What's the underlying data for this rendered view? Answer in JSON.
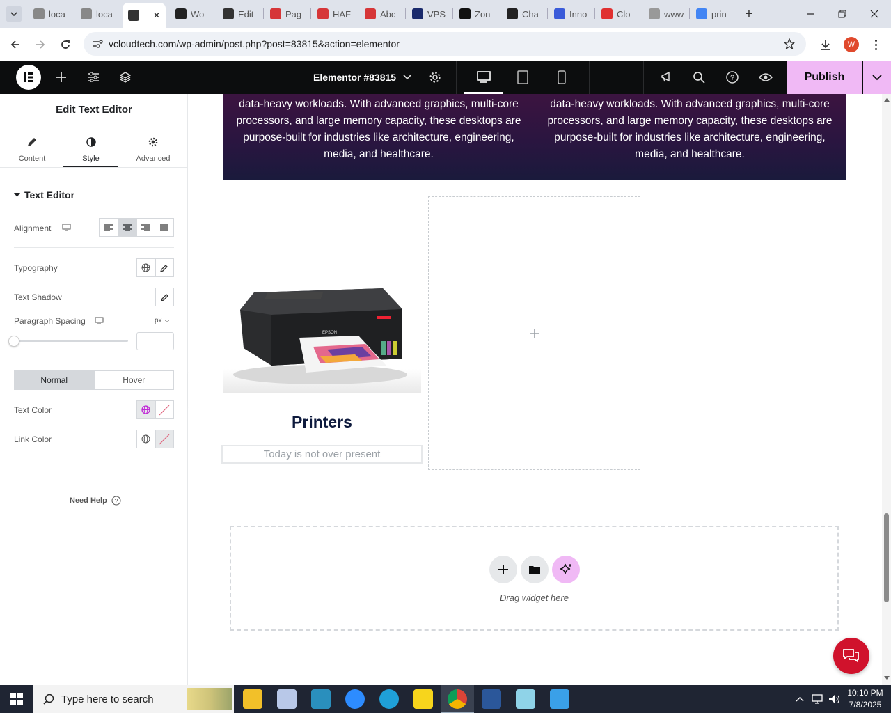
{
  "browser": {
    "tabs": [
      {
        "label": "loca",
        "color": "#888"
      },
      {
        "label": "loca",
        "color": "#888"
      },
      {
        "label": "",
        "color": "#333"
      },
      {
        "label": "Wo",
        "color": "#222"
      },
      {
        "label": "Edit",
        "color": "#333"
      },
      {
        "label": "Pag",
        "color": "#d63638"
      },
      {
        "label": "HAF",
        "color": "#d63638"
      },
      {
        "label": "Abc",
        "color": "#d63638"
      },
      {
        "label": "VPS",
        "color": "#1a2a6c"
      },
      {
        "label": "Zon",
        "color": "#111"
      },
      {
        "label": "Cha",
        "color": "#222"
      },
      {
        "label": "Inno",
        "color": "#3a5bd9"
      },
      {
        "label": "Clo",
        "color": "#e03030"
      },
      {
        "label": "www",
        "color": "#999"
      },
      {
        "label": "prin",
        "color": "#4285f4"
      }
    ],
    "url": "vcloudtech.com/wp-admin/post.php?post=83815&action=elementor",
    "profile_initial": "W"
  },
  "editor": {
    "document_title": "Elementor #83815",
    "publish_label": "Publish"
  },
  "panel": {
    "title": "Edit Text Editor",
    "tabs": [
      {
        "label": "Content"
      },
      {
        "label": "Style"
      },
      {
        "label": "Advanced"
      }
    ],
    "section_title": "Text Editor",
    "alignment_label": "Alignment",
    "typography_label": "Typography",
    "text_shadow_label": "Text Shadow",
    "paragraph_spacing_label": "Paragraph Spacing",
    "unit_label": "px",
    "state_normal": "Normal",
    "state_hover": "Hover",
    "text_color_label": "Text Color",
    "link_color_label": "Link Color",
    "need_help": "Need Help"
  },
  "canvas": {
    "banner_left": "data-heavy workloads. With advanced graphics, multi-core processors, and large memory capacity, these desktops are purpose-built for industries like architecture, engineering, media, and healthcare.",
    "banner_right": "data-heavy workloads. With advanced graphics, multi-core processors, and large memory capacity, these desktops are purpose-built for industries like architecture, engineering, media, and healthcare.",
    "card_title": "Printers",
    "card_text": "Today is not over present",
    "printer_brand": "EPSON",
    "drag_hint": "Drag widget here"
  },
  "taskbar": {
    "search_placeholder": "Type here to search",
    "time": "10:10 PM",
    "date": "7/8/2025"
  },
  "colors": {
    "accent_publish": "#f0b9f5",
    "banner": "#3a1640",
    "chat_button": "#d0122c"
  }
}
